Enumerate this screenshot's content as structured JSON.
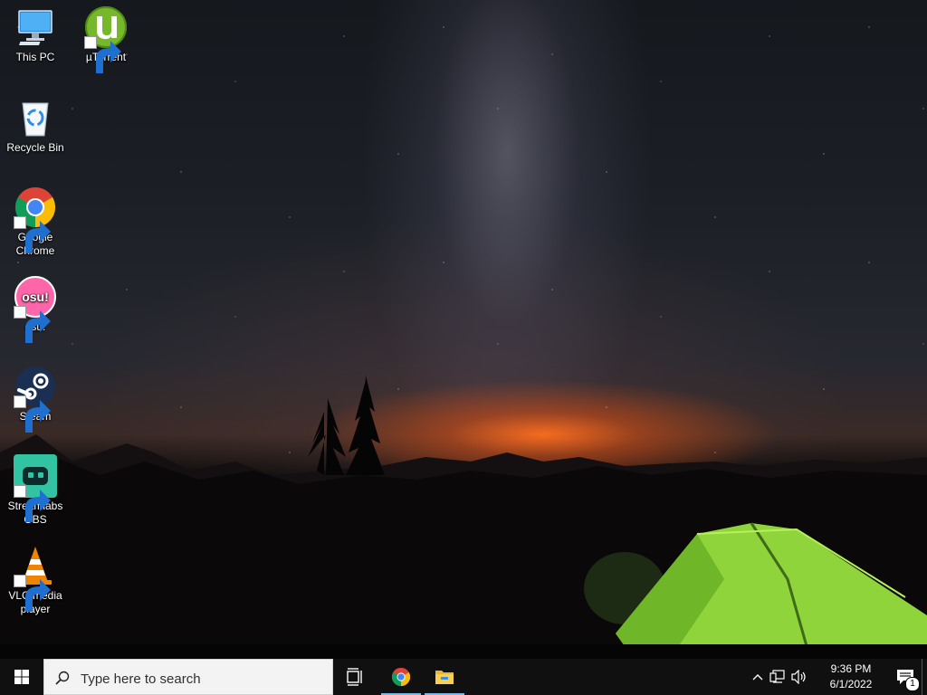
{
  "desktop": {
    "icons": [
      {
        "label": "This PC",
        "icon": "computer-icon",
        "shortcut": false
      },
      {
        "label": "µTorrent",
        "icon": "utorrent-icon",
        "shortcut": true
      },
      {
        "label": "Recycle Bin",
        "icon": "recycle-bin-icon",
        "shortcut": false
      },
      {
        "label": "Google Chrome",
        "icon": "chrome-icon",
        "shortcut": true
      },
      {
        "label": "osu!",
        "icon": "osu-icon",
        "shortcut": true
      },
      {
        "label": "Steam",
        "icon": "steam-icon",
        "shortcut": true
      },
      {
        "label": "Streamlabs OBS",
        "icon": "streamlabs-obs-icon",
        "shortcut": true
      },
      {
        "label": "VLC media player",
        "icon": "vlc-icon",
        "shortcut": true
      }
    ],
    "osu_logo_text": "osu!"
  },
  "taskbar": {
    "search_placeholder": "Type here to search",
    "start_icon": "windows-logo-icon",
    "pinned": [
      {
        "name": "task-view",
        "icon": "task-view-icon",
        "active": false
      },
      {
        "name": "chrome",
        "icon": "chrome-icon",
        "active": true
      },
      {
        "name": "file-explorer",
        "icon": "folder-icon",
        "active": true
      }
    ],
    "tray": {
      "time": "9:36 PM",
      "date": "6/1/2022",
      "notification_count": "1"
    }
  },
  "colors": {
    "taskbar": "#101010",
    "active_indicator": "#76b9ed",
    "tent": "#8fd43a"
  }
}
